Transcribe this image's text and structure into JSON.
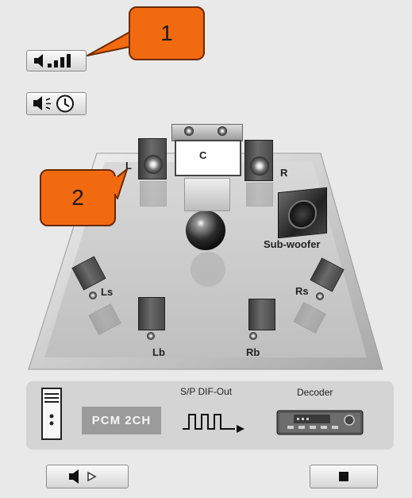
{
  "callouts": {
    "one": "1",
    "two": "2"
  },
  "speakers": {
    "center": "C",
    "left": "L",
    "right": "R",
    "subwoofer": "Sub-woofer",
    "left_surround": "Ls",
    "right_surround": "Rs",
    "left_back": "Lb",
    "right_back": "Rb"
  },
  "output": {
    "spdif_label": "S/P DIF-Out",
    "decoder_label": "Decoder",
    "format_badge": "PCM 2CH"
  },
  "colors": {
    "callout": "#f26a10",
    "background": "#e9e9e9",
    "room_floor": "#c9c9c9"
  },
  "icons": {
    "volume": "speaker-level-bars-icon",
    "delay": "speaker-clock-icon",
    "play": "speaker-play-icon",
    "stop": "stop-square-icon"
  }
}
